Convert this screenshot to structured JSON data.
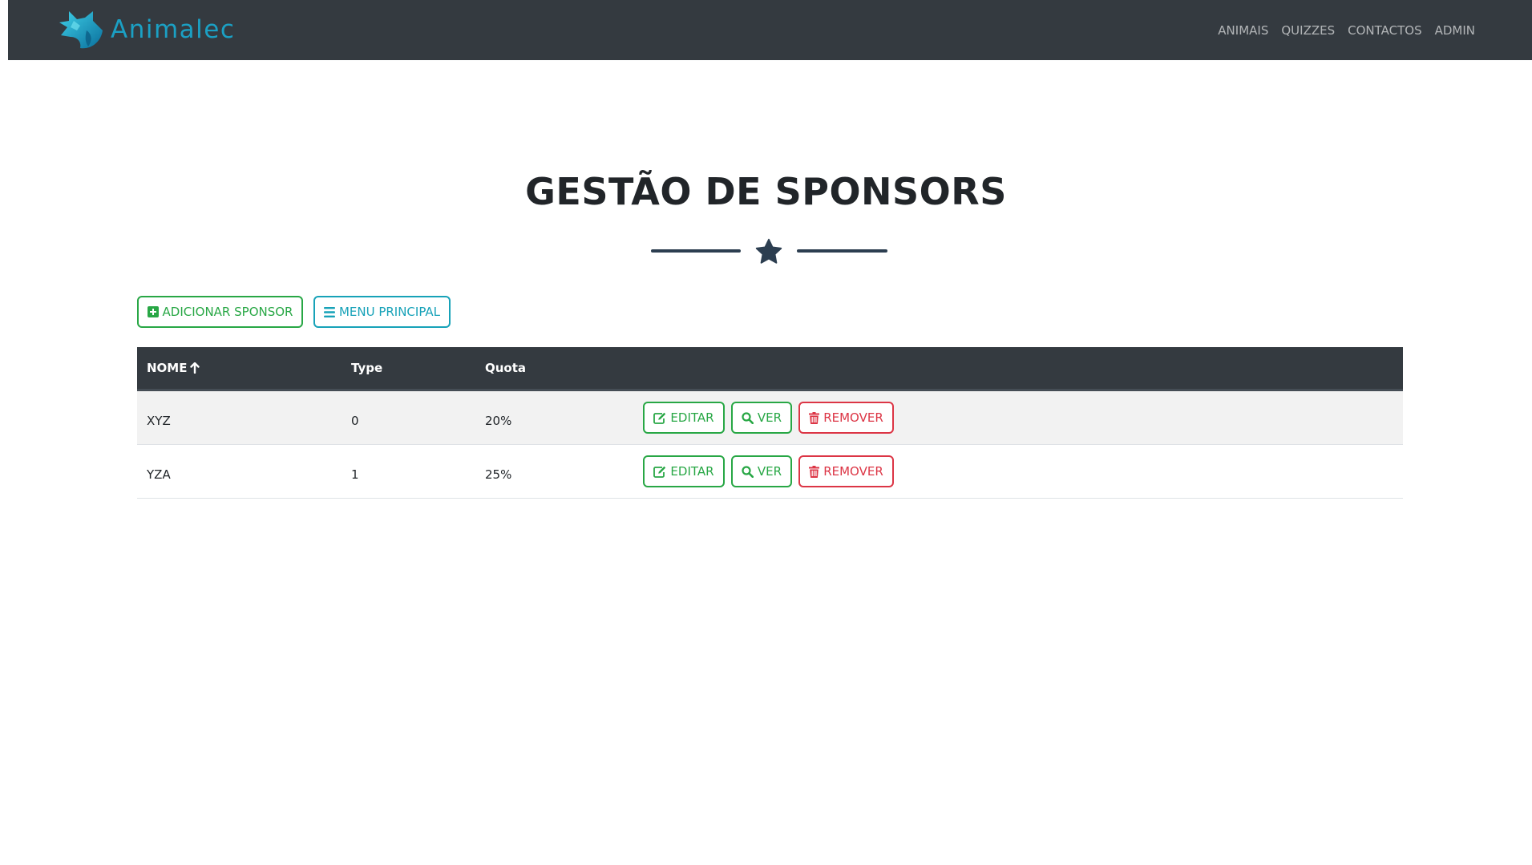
{
  "brand": {
    "name": "Animalec"
  },
  "nav": {
    "items": [
      {
        "label": "ANIMAIS"
      },
      {
        "label": "QUIZZES"
      },
      {
        "label": "CONTACTOS"
      },
      {
        "label": "ADMIN"
      }
    ]
  },
  "page": {
    "title": "GESTÃO DE SPONSORS"
  },
  "toolbar": {
    "add_label": "ADICIONAR SPONSOR",
    "menu_label": "MENU PRINCIPAL"
  },
  "table": {
    "headers": {
      "nome": "NOME",
      "type": "Type",
      "quota": "Quota"
    },
    "rows": [
      {
        "nome": "XYZ",
        "type": "0",
        "quota": "20%"
      },
      {
        "nome": "YZA",
        "type": "1",
        "quota": "25%"
      }
    ],
    "actions": {
      "edit": "EDITAR",
      "view": "VER",
      "remove": "REMOVER"
    }
  },
  "colors": {
    "navbar": "#343a40",
    "brand": "#1ba0c4",
    "success": "#28a745",
    "info": "#17a2b8",
    "danger": "#dc3545",
    "divider": "#2c3e50"
  },
  "icons": {
    "logo": "wolf-logo-icon",
    "divider": "star-icon",
    "add": "plus-square-icon",
    "menu": "bars-icon",
    "sort": "arrow-up-icon",
    "edit": "edit-icon",
    "view": "search-icon",
    "remove": "trash-icon"
  }
}
